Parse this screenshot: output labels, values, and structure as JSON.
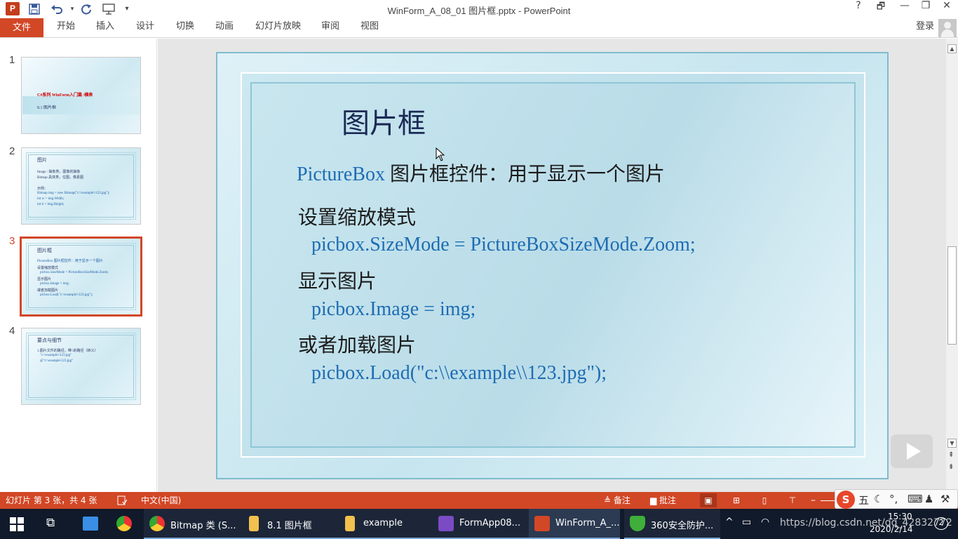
{
  "window": {
    "title": "WinForm_A_08_01 图片框.pptx - PowerPoint",
    "help": "?",
    "restore_ribbon": "🗗",
    "minimize": "—",
    "maximize": "❐",
    "close": "✕"
  },
  "quick_access": {
    "app_icon": "P",
    "save_icon": "save-icon",
    "undo_icon": "undo-icon",
    "redo_icon": "redo-icon",
    "present_icon": "present-icon",
    "customize_icon": "chevron-down-icon"
  },
  "ribbon": {
    "file": "文件",
    "tabs": [
      "开始",
      "插入",
      "设计",
      "切换",
      "动画",
      "幻灯片放映",
      "审阅",
      "视图"
    ],
    "sign_in": "登录"
  },
  "thumbnails": [
    {
      "num": "1",
      "lines": [
        "C#系列   WinForm入门篇   /横表",
        "8.1  图片框"
      ]
    },
    {
      "num": "2",
      "lines": [
        "图片",
        "Image : 抽象类，图像的抽象",
        "Bitmap 具体类，位图，像素图",
        "示例：",
        "Bitmap img = new Bitmap(\"c:\\\\example\\\\123.jpg\");",
        "int w = img.Width;",
        "int h = img.Height;"
      ]
    },
    {
      "num": "3",
      "lines": [
        "图片框",
        "PictureBox 图片框控件：用于显示一个图片",
        "设置缩放模式",
        "picbox.SizeMode = PictureBoxSizeMode.Zoom;",
        "显示图片",
        "picbox.Image = img;",
        "或者加载图片",
        "picbox.Load(\"c:\\\\example\\\\123.jpg\");"
      ]
    },
    {
      "num": "4",
      "lines": [
        "要点与细节",
        "1.图片文件的路径，带\\\\的路径（转义）",
        "\"c:\\\\example\\\\123.jpg\"",
        "@\"c:\\example\\123.jpg\""
      ]
    }
  ],
  "slide": {
    "title": "图片框",
    "line1_code": "PictureBox",
    "line1_text": " 图片框控件：用于显示一个图片",
    "line2": "设置缩放模式",
    "line3": "picbox.SizeMode = PictureBoxSizeMode.Zoom;",
    "line4": "显示图片",
    "line5": "picbox.Image = img;",
    "line6": "或者加载图片",
    "line7": "picbox.Load(\"c:\\\\example\\\\123.jpg\");"
  },
  "statusbar": {
    "slide_info": "幻灯片 第 3 张，共 4 张",
    "language": "中文(中国)",
    "notes": "备注",
    "comments": "批注"
  },
  "taskbar": {
    "items": [
      {
        "label": "Bitmap 类 (S...",
        "icon": "chrome-icon"
      },
      {
        "label": "8.1 图片框",
        "icon": "folder-icon"
      },
      {
        "label": "example",
        "icon": "folder-icon"
      },
      {
        "label": "FormApp08...",
        "icon": "visual-studio-icon"
      },
      {
        "label": "WinForm_A_...",
        "icon": "powerpoint-icon"
      },
      {
        "label": "360安全防护...",
        "icon": "shield-icon"
      }
    ],
    "time": "15:30",
    "date": "2020/2/14",
    "watermark": "https://blog.csdn.net/qq_42832772"
  },
  "ime": {
    "logo": "S",
    "mode": "五"
  },
  "colors": {
    "accent": "#d24726",
    "slide_code": "#1e6cb3",
    "taskbar": "#101a2a"
  }
}
